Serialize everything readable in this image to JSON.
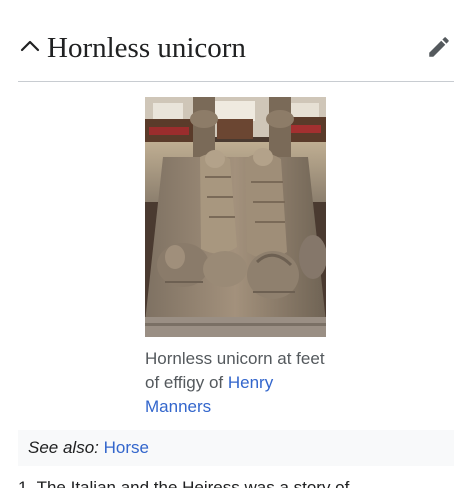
{
  "section": {
    "title": "Hornless unicorn"
  },
  "figure": {
    "caption_text": "Hornless unicorn at feet of effigy of",
    "caption_link": "Henry Manners"
  },
  "hatnote": {
    "label": "See also:",
    "link": "Horse"
  },
  "body": {
    "partial_line": "1. The Italian and the Heiress was a story of"
  },
  "icons": {
    "collapse": "chevron-up-icon",
    "edit": "pencil-icon"
  },
  "colors": {
    "link": "#3366cc",
    "text": "#202122",
    "caption": "#54595d",
    "hatnote_bg": "#f8f9fa",
    "divider": "#c8ccd1"
  }
}
